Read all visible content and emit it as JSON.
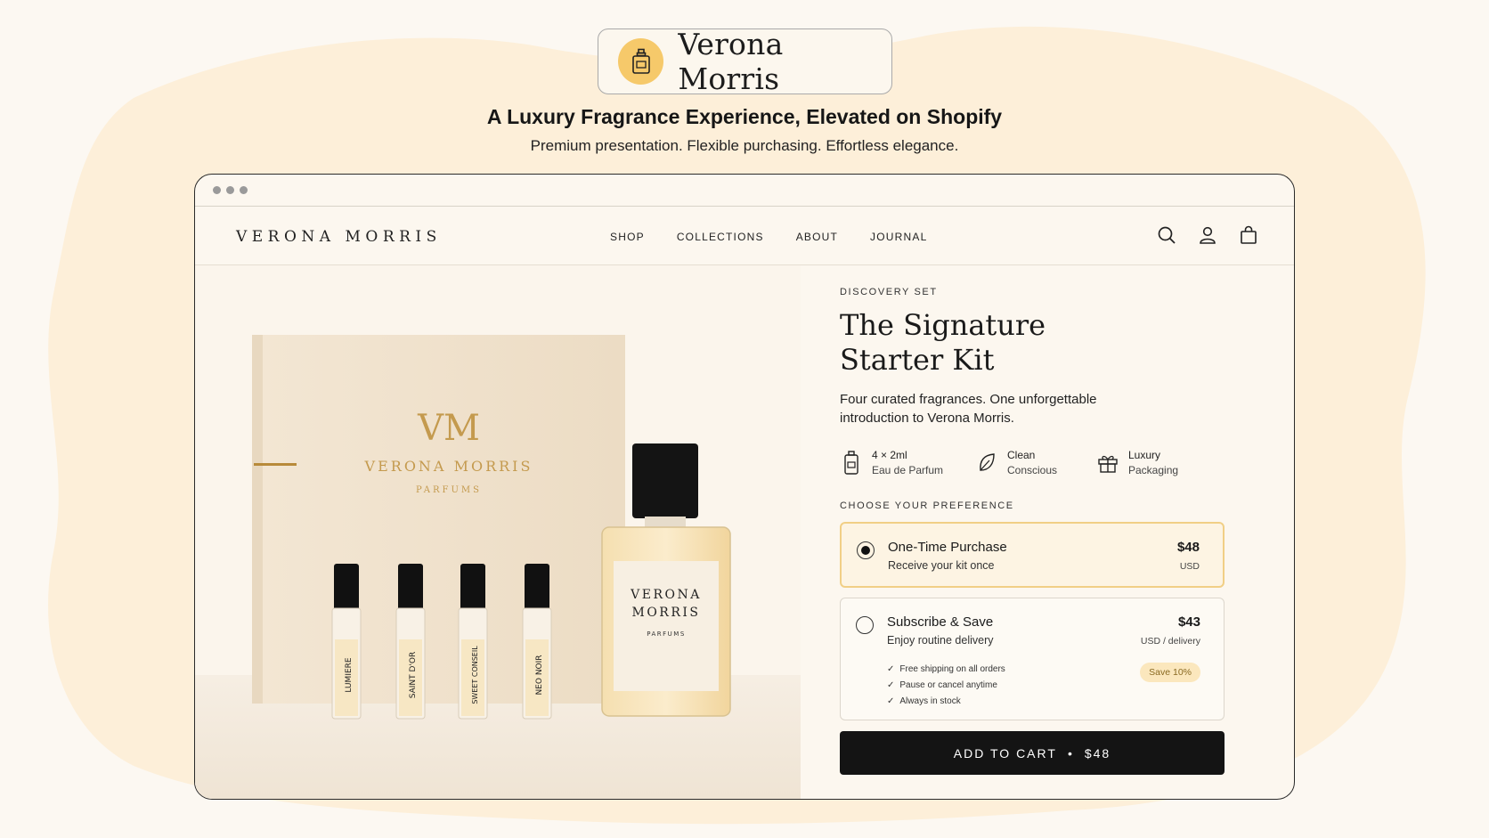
{
  "hero": {
    "logo_icon": "perfume-bottle-icon",
    "brand_name": "Verona Morris",
    "headline": "A Luxury Fragrance Experience, Elevated on Shopify",
    "subheadline": "Premium presentation. Flexible purchasing. Effortless elegance."
  },
  "colors": {
    "background": "#fcf8f2",
    "blob": "#fdefd9",
    "accent": "#f6c96a",
    "selected_border": "#f1cf86",
    "button": "#141414"
  },
  "store": {
    "brand": "VERONA MORRIS",
    "nav": [
      "SHOP",
      "COLLECTIONS",
      "ABOUT",
      "JOURNAL"
    ],
    "icons": [
      "search-icon",
      "account-icon",
      "bag-icon"
    ]
  },
  "product": {
    "box": {
      "monogram": "VM",
      "brand": "VERONA MORRIS",
      "sub": "PARFUMS"
    },
    "vials": [
      "LUMIERE",
      "SAINT D'OR",
      "SWEET CONSEIL",
      "NEO NOIR"
    ],
    "bottle": {
      "line1": "VERONA",
      "line2": "MORRIS",
      "line3": "PARFUMS"
    },
    "eyebrow": "DISCOVERY SET",
    "title": "The Signature Starter Kit",
    "description": "Four curated fragrances. One unforgettable introduction to Verona Morris.",
    "features": [
      {
        "icon": "vial-icon",
        "line1": "4 × 2ml",
        "line2": "Eau de Parfum"
      },
      {
        "icon": "leaf-icon",
        "line1": "Clean",
        "line2": "Conscious"
      },
      {
        "icon": "gift-icon",
        "line1": "Luxury",
        "line2": "Packaging"
      }
    ],
    "preference_label": "CHOOSE YOUR PREFERENCE",
    "options": [
      {
        "title": "One-Time Purchase",
        "subtitle": "Receive your kit once",
        "price": "$48",
        "unit": "USD",
        "selected": true
      },
      {
        "title": "Subscribe & Save",
        "subtitle": "Enjoy routine delivery",
        "price": "$43",
        "unit": "USD / delivery",
        "selected": false,
        "benefits": [
          "Free shipping on all orders",
          "Pause or cancel anytime",
          "Always in stock"
        ],
        "badge": "Save 10%"
      }
    ],
    "cart": {
      "label": "ADD TO CART",
      "separator": "•",
      "price": "$48"
    }
  }
}
